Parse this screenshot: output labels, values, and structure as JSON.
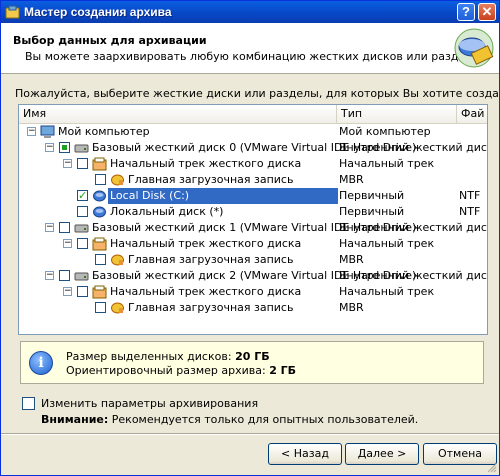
{
  "window": {
    "title": "Мастер создания архива"
  },
  "header": {
    "title": "Выбор данных для архивации",
    "subtitle": "Вы можете заархивировать любую комбинацию жестких дисков или разделов."
  },
  "prompt": "Пожалуйста, выберите жесткие диски или разделы, для которых Вы хотите создать архив",
  "columns": {
    "name": "Имя",
    "type": "Тип",
    "fs": "Фай"
  },
  "rows": [
    {
      "name": "Мой компьютер",
      "type": "Мой компьютер",
      "fs": "",
      "icon": "computer-icon"
    },
    {
      "name": "Базовый жесткий диск 0 (VMware Virtual IDE Hard Drive)",
      "type": "Внутренний жесткий диск",
      "fs": "",
      "icon": "hard-disk-icon"
    },
    {
      "name": "Начальный трек жесткого диска",
      "type": "Начальный трек",
      "fs": "",
      "icon": "track-icon"
    },
    {
      "name": "Главная загрузочная запись",
      "type": "MBR",
      "fs": "",
      "icon": "mbr-icon"
    },
    {
      "name": "Local Disk (C:)",
      "type": "Первичный",
      "fs": "NTF",
      "icon": "partition-icon"
    },
    {
      "name": "Локальный диск (*)",
      "type": "Первичный",
      "fs": "NTF",
      "icon": "partition-icon"
    },
    {
      "name": "Базовый жесткий диск 1 (VMware Virtual IDE Hard Drive)",
      "type": "Внутренний жесткий диск",
      "fs": "",
      "icon": "hard-disk-icon"
    },
    {
      "name": "Начальный трек жесткого диска",
      "type": "Начальный трек",
      "fs": "",
      "icon": "track-icon"
    },
    {
      "name": "Главная загрузочная запись",
      "type": "MBR",
      "fs": "",
      "icon": "mbr-icon"
    },
    {
      "name": "Базовый жесткий диск 2 (VMware Virtual IDE Hard Drive)",
      "type": "Внутренний жесткий диск",
      "fs": "",
      "icon": "hard-disk-icon"
    },
    {
      "name": "Начальный трек жесткого диска",
      "type": "Начальный трек",
      "fs": "",
      "icon": "track-icon"
    },
    {
      "name": "Главная загрузочная запись",
      "type": "MBR",
      "fs": "",
      "icon": "mbr-icon"
    }
  ],
  "info": {
    "selected_label": "Размер выделенных дисков:",
    "selected_value": "20 ГБ",
    "estimate_label": "Ориентировочный размер архива:",
    "estimate_value": "2 ГБ"
  },
  "options": {
    "change_params": "Изменить параметры архивирования",
    "warning_label": "Внимание:",
    "warning_text": "Рекомендуется только для опытных пользователей."
  },
  "buttons": {
    "back": "< Назад",
    "next": "Далее >",
    "cancel": "Отмена"
  },
  "colors": {
    "title_bar": "#0a5fe0",
    "selection": "#316ac5",
    "info_bg": "#ffffe1",
    "dialog_bg": "#ece9d8"
  }
}
